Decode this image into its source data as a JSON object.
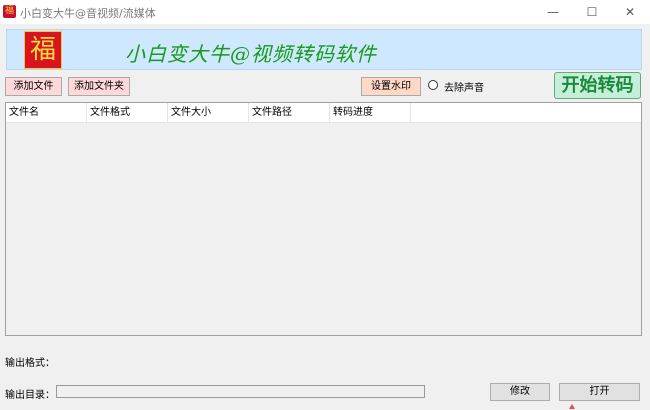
{
  "window": {
    "title": "小白变大牛@音视频/流媒体",
    "minimize_glyph": "—",
    "maximize_glyph": "☐",
    "close_glyph": "✕",
    "icon": "fu-logo-icon"
  },
  "banner": {
    "fu_char": "福",
    "title": "小白变大牛@视频转码软件"
  },
  "toolbar": {
    "add_file": "添加文件",
    "add_folder": "添加文件夹",
    "watermark": "设置水印",
    "remove_audio": "去除声音",
    "start": "开始转码"
  },
  "table": {
    "columns": [
      "文件名",
      "文件格式",
      "文件大小",
      "文件路径",
      "转码进度"
    ],
    "rows": []
  },
  "footer": {
    "output_format_label": "输出格式：",
    "output_dir_label": "输出目录：",
    "modify": "修改",
    "open": "打开"
  },
  "colors": {
    "banner_bg": "#cde8ff",
    "banner_text": "#1a9a1a",
    "start_bg": "#c6efd9",
    "add_btn_bg": "#ffd9d9",
    "watermark_bg": "#ffd8c6"
  }
}
